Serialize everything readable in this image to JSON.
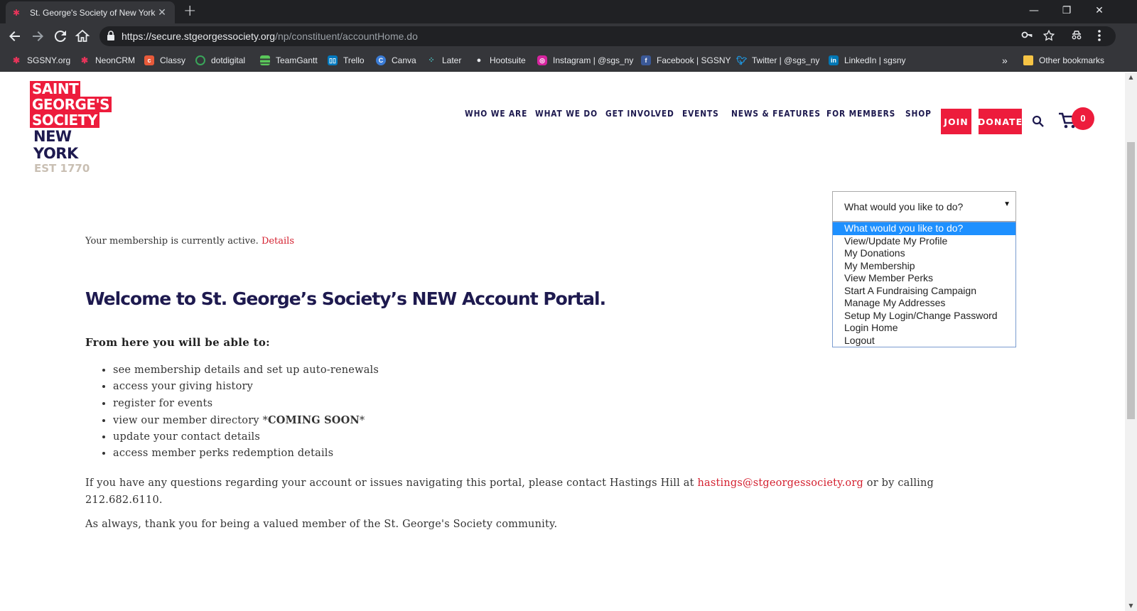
{
  "browser": {
    "tab_title": "St. George's Society of New York",
    "tab_close": "✕",
    "new_tab": "+",
    "url_host": "https://secure.stgeorgessociety.org",
    "url_path": "/np/constituent/accountHome.do",
    "window_controls": [
      "—",
      "❐",
      "✕"
    ]
  },
  "bookmarks": [
    {
      "label": "SGSNY.org",
      "icon": "sgsny-icon",
      "color": "#e8345a"
    },
    {
      "label": "NeonCRM",
      "icon": "neoncrm-icon",
      "color": "#e8345a"
    },
    {
      "label": "Classy",
      "icon": "classy-icon",
      "color": "#e85a3a"
    },
    {
      "label": "dotdigital",
      "icon": "dotdigital-icon",
      "color": "#3aa55a"
    },
    {
      "label": "TeamGantt",
      "icon": "teamgantt-icon",
      "color": "#5ac85a"
    },
    {
      "label": "Trello",
      "icon": "trello-icon",
      "color": "#0079bf"
    },
    {
      "label": "Canva",
      "icon": "canva-icon",
      "color": "#3a7bd5"
    },
    {
      "label": "Later",
      "icon": "later-icon",
      "color": "#4ac0c0"
    },
    {
      "label": "Hootsuite",
      "icon": "hootsuite-icon",
      "color": "#444444"
    },
    {
      "label": "Instagram | @sgs_ny",
      "icon": "instagram-icon",
      "color": "#d6249f"
    },
    {
      "label": "Facebook | SGSNY",
      "icon": "facebook-icon",
      "color": "#3b5998"
    },
    {
      "label": "Twitter | @sgs_ny",
      "icon": "twitter-icon",
      "color": "#1da1f2"
    },
    {
      "label": "LinkedIn | sgsny",
      "icon": "linkedin-icon",
      "color": "#0077b5"
    }
  ],
  "bookmarks_overflow": "»",
  "other_bookmarks": "Other bookmarks",
  "site": {
    "logo": {
      "line1": "SAINT",
      "line2": "GEORGE'S",
      "line3": "SOCIETY",
      "line4": "NEW YORK",
      "line5": "EST 1770"
    },
    "nav": [
      "WHO WE ARE",
      "WHAT WE DO",
      "GET INVOLVED",
      "EVENTS",
      "NEWS & FEATURES",
      "FOR MEMBERS",
      "SHOP"
    ],
    "join": "JOIN",
    "donate": "DONATE",
    "cart_count": "0",
    "accent": "#ed1c3c",
    "navy": "#1e1a4f"
  },
  "status": {
    "text": "Your membership is currently active.",
    "link": "Details"
  },
  "welcome": "Welcome to St. George’s Society’s NEW Account Portal.",
  "from_here": "From here you will be able to:",
  "bullets": {
    "b1": "see membership details and set up auto-renewals",
    "b2": "access your giving history",
    "b3": "register for events",
    "b4_pre": "view our member directory *",
    "b4_bold": "COMING SOON",
    "b4_post": "*",
    "b5": "update your contact details",
    "b6": "access member perks redemption details"
  },
  "contact": {
    "pre": "If you have any questions regarding your account or issues navigating this portal, please contact Hastings Hill at",
    "email": "hastings@stgeorgessociety.org",
    "post": "or by calling 212.682.6110."
  },
  "thanks": "As always, thank you for being a valued member of the St. George's Society community.",
  "dropdown": {
    "value": "What would you like to do?",
    "options": [
      "What would you like to do?",
      "View/Update My Profile",
      "My Donations",
      "My Membership",
      "View Member Perks",
      "Start A Fundraising Campaign",
      "Manage My Addresses",
      "Setup My Login/Change Password",
      "Login Home",
      "Logout"
    ]
  }
}
